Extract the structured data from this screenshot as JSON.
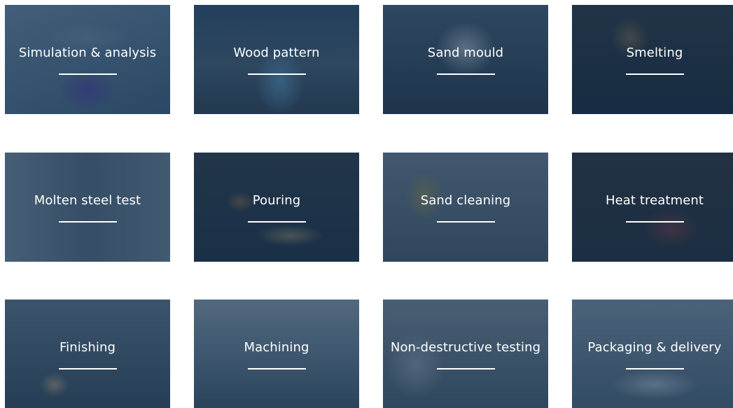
{
  "colors": {
    "overlay": "#14304e",
    "text": "#ffffff",
    "rule": "#ffffff"
  },
  "process_steps": [
    {
      "label": "Simulation & analysis"
    },
    {
      "label": "Wood pattern"
    },
    {
      "label": "Sand mould"
    },
    {
      "label": "Smelting"
    },
    {
      "label": "Molten steel test"
    },
    {
      "label": "Pouring"
    },
    {
      "label": "Sand cleaning"
    },
    {
      "label": "Heat treatment"
    },
    {
      "label": "Finishing"
    },
    {
      "label": "Machining"
    },
    {
      "label": "Non-destructive testing"
    },
    {
      "label": "Packaging & delivery"
    }
  ]
}
